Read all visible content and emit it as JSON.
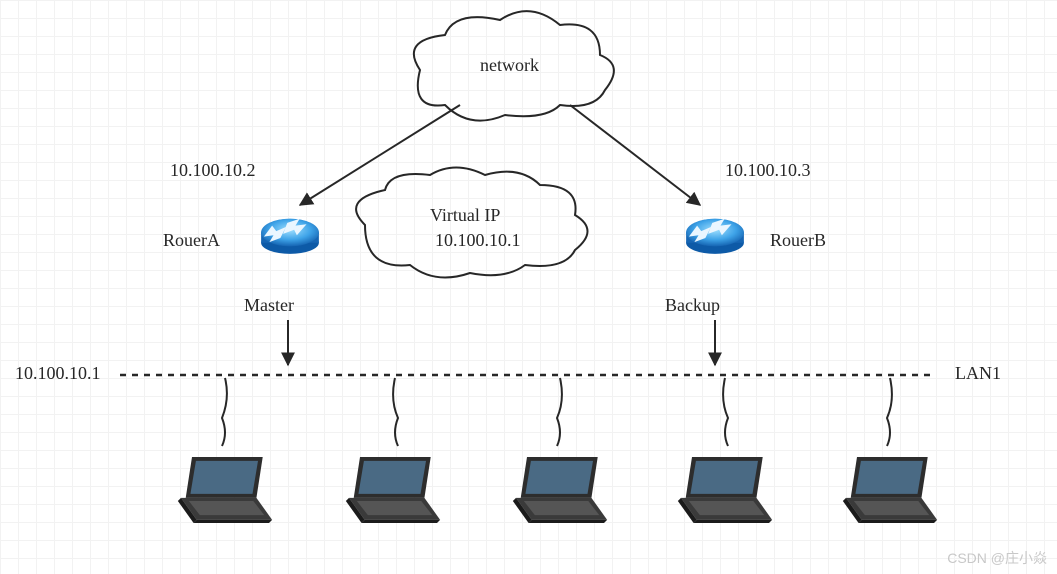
{
  "networkCloud": {
    "label": "network"
  },
  "virtualCloud": {
    "line1": "Virtual IP",
    "line2": "10.100.10.1"
  },
  "routerA": {
    "ip": "10.100.10.2",
    "name": "RouerA",
    "role": "Master"
  },
  "routerB": {
    "ip": "10.100.10.3",
    "name": "RouerB",
    "role": "Backup"
  },
  "lan": {
    "leftIp": "10.100.10.1",
    "name": "LAN1"
  },
  "watermark": "CSDN @庄小焱"
}
